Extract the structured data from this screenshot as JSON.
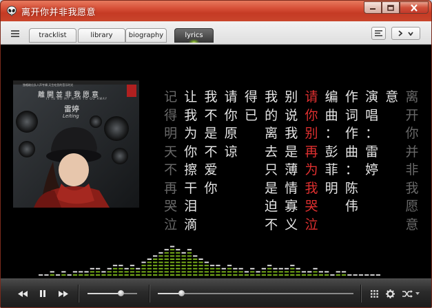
{
  "window": {
    "title": "离开你并非我愿意"
  },
  "tabs": [
    {
      "label": "tracklist",
      "active": false
    },
    {
      "label": "library",
      "active": false
    },
    {
      "label": "biography",
      "active": false
    },
    {
      "label": "lyrics",
      "active": true
    }
  ],
  "album": {
    "cover_title": "離開並非我愿意",
    "cover_subtitle": "IT IS NO MY WISH TO GO AWAY",
    "cover_top_text": "独唱继仕队人声专辑 天生吃货的音乐时光",
    "artist_chinese": "雷婷",
    "artist_latin": "Leiting"
  },
  "lyrics": {
    "lines": [
      {
        "text": "离开你并非我愿意",
        "highlight": false
      },
      {
        "text": "意",
        "highlight": false
      },
      {
        "text": "演唱：雷婷",
        "highlight": false
      },
      {
        "text": "作词作曲：陈伟",
        "highlight": false
      },
      {
        "text": "编曲：彭菲明",
        "highlight": false
      },
      {
        "text": "请你别再为我哭泣",
        "highlight": true
      },
      {
        "text": "别说我是薄情寡义",
        "highlight": false
      },
      {
        "text": "我的离去只是迫不",
        "highlight": false
      },
      {
        "text": "得已",
        "highlight": false
      },
      {
        "text": "请你原谅",
        "highlight": false
      },
      {
        "text": "我不是不爱你",
        "highlight": false
      },
      {
        "text": "让我为你擦干泪滴",
        "highlight": false
      },
      {
        "text": "记得明天不再哭泣",
        "highlight": false
      }
    ]
  },
  "player": {
    "volume": 0.67,
    "progress": 0.12
  },
  "colors": {
    "titlebar": "#c53a24",
    "lyric_highlight": "#e03030",
    "lyric_normal": "#e6e6e6",
    "visualizer": "#8ccc1e"
  },
  "icons": {
    "menu": "hamburger-icon",
    "list_view": "list-icon",
    "nav": "chevron-right-icon",
    "nav_menu": "chevron-down-icon",
    "prev": "rewind-icon",
    "pause": "pause-icon",
    "next": "fast-forward-icon",
    "grid": "grid-icon",
    "settings": "gear-icon",
    "shuffle": "shuffle-icon"
  }
}
